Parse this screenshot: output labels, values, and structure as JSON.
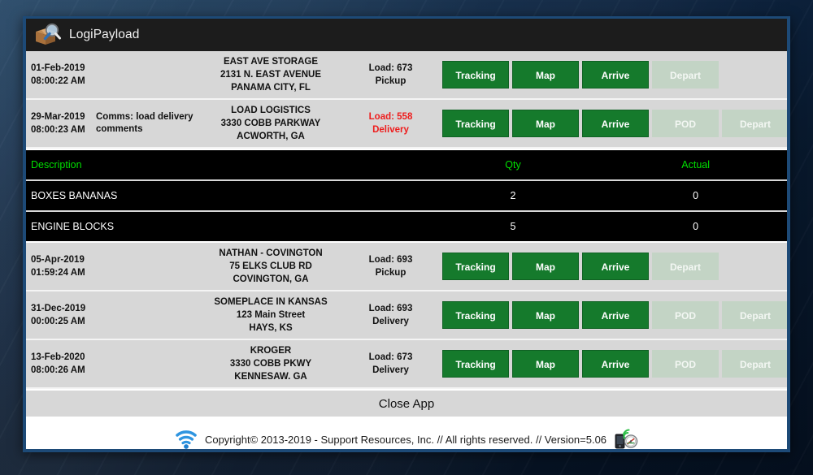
{
  "window": {
    "title": "LogiPayload",
    "logo_icon": "box-magnifier-icon"
  },
  "colors": {
    "button_green": "#157a2c",
    "button_disabled": "#c3d4c5",
    "delivery_red": "#ee1c1c",
    "header_green": "#00e000",
    "row_gray": "#d7d7d7",
    "titlebar_black": "#1c1c1c",
    "window_border_blue": "#1d4a77"
  },
  "stops": [
    {
      "date": "01-Feb-2019",
      "time": "08:00:22 AM",
      "comms": "",
      "name": "EAST AVE STORAGE",
      "street": "2131 N. EAST AVENUE",
      "city": "PANAMA CITY, FL",
      "load": "Load: 673",
      "type": "Pickup",
      "is_delivery": false,
      "buttons": [
        {
          "label": "Tracking",
          "enabled": true
        },
        {
          "label": "Map",
          "enabled": true
        },
        {
          "label": "Arrive",
          "enabled": true
        },
        {
          "label": "Depart",
          "enabled": false
        }
      ]
    },
    {
      "date": "29-Mar-2019",
      "time": "08:00:23 AM",
      "comms": "Comms: load delivery comments",
      "name": "LOAD LOGISTICS",
      "street": "3330 COBB PARKWAY",
      "city": "ACWORTH, GA",
      "load": "Load: 558",
      "type": "Delivery",
      "is_delivery": true,
      "buttons": [
        {
          "label": "Tracking",
          "enabled": true
        },
        {
          "label": "Map",
          "enabled": true
        },
        {
          "label": "Arrive",
          "enabled": true
        },
        {
          "label": "POD",
          "enabled": false
        },
        {
          "label": "Depart",
          "enabled": false
        }
      ]
    },
    {
      "date": "05-Apr-2019",
      "time": "01:59:24 AM",
      "comms": "",
      "name": "NATHAN - COVINGTON",
      "street": "75 ELKS CLUB RD",
      "city": "COVINGTON, GA",
      "load": "Load: 693",
      "type": "Pickup",
      "is_delivery": false,
      "buttons": [
        {
          "label": "Tracking",
          "enabled": true
        },
        {
          "label": "Map",
          "enabled": true
        },
        {
          "label": "Arrive",
          "enabled": true
        },
        {
          "label": "Depart",
          "enabled": false
        }
      ]
    },
    {
      "date": "31-Dec-2019",
      "time": "00:00:25 AM",
      "comms": "",
      "name": "SOMEPLACE IN KANSAS",
      "street": "123 Main Street",
      "city": "HAYS, KS",
      "load": "Load: 693",
      "type": "Delivery",
      "is_delivery": false,
      "buttons": [
        {
          "label": "Tracking",
          "enabled": true
        },
        {
          "label": "Map",
          "enabled": true
        },
        {
          "label": "Arrive",
          "enabled": true
        },
        {
          "label": "POD",
          "enabled": false
        },
        {
          "label": "Depart",
          "enabled": false
        }
      ]
    },
    {
      "date": "13-Feb-2020",
      "time": "08:00:26 AM",
      "comms": "",
      "name": "KROGER",
      "street": "3330 COBB PKWY",
      "city": "KENNESAW. GA",
      "load": "Load: 673",
      "type": "Delivery",
      "is_delivery": false,
      "buttons": [
        {
          "label": "Tracking",
          "enabled": true
        },
        {
          "label": "Map",
          "enabled": true
        },
        {
          "label": "Arrive",
          "enabled": true
        },
        {
          "label": "POD",
          "enabled": false
        },
        {
          "label": "Depart",
          "enabled": false
        }
      ]
    }
  ],
  "items_table": {
    "headers": {
      "description": "Description",
      "qty": "Qty",
      "actual": "Actual"
    },
    "rows": [
      {
        "description": "BOXES BANANAS",
        "qty": "2",
        "actual": "0"
      },
      {
        "description": "ENGINE BLOCKS",
        "qty": "5",
        "actual": "0"
      }
    ]
  },
  "close_bar": {
    "label": "Close App"
  },
  "footer": {
    "wifi_icon": "wifi-icon",
    "copyright": "Copyright© 2013-2019 - Support Resources, Inc. // All rights reserved. //  Version=5.06",
    "device_icon": "phone-gauge-icon"
  }
}
